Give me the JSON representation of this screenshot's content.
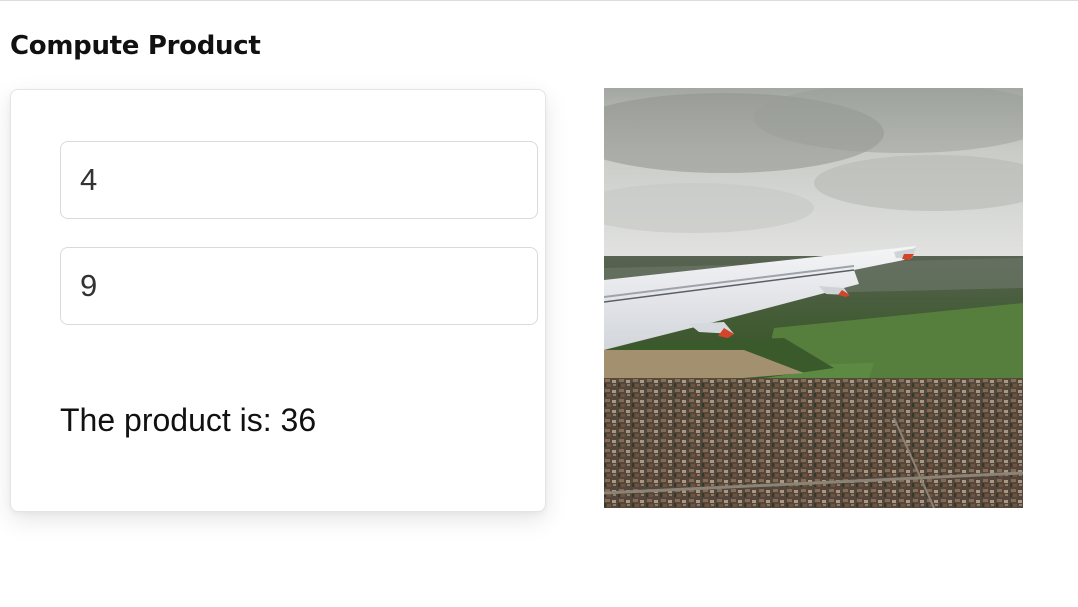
{
  "header": {
    "title": "Compute Product"
  },
  "form": {
    "first_value": "4",
    "second_value": "9",
    "result_label": "The product is:",
    "result_value": "36"
  },
  "image": {
    "subject": "airplane-wing-over-city",
    "colors": {
      "sky": "#d4d5d2",
      "cloud_dark": "#8e928c",
      "field_green": "#4f7a3c",
      "city_brown": "#6a5646",
      "wing": "#e9ebee",
      "wingtip_accent": "#d2452a"
    }
  }
}
